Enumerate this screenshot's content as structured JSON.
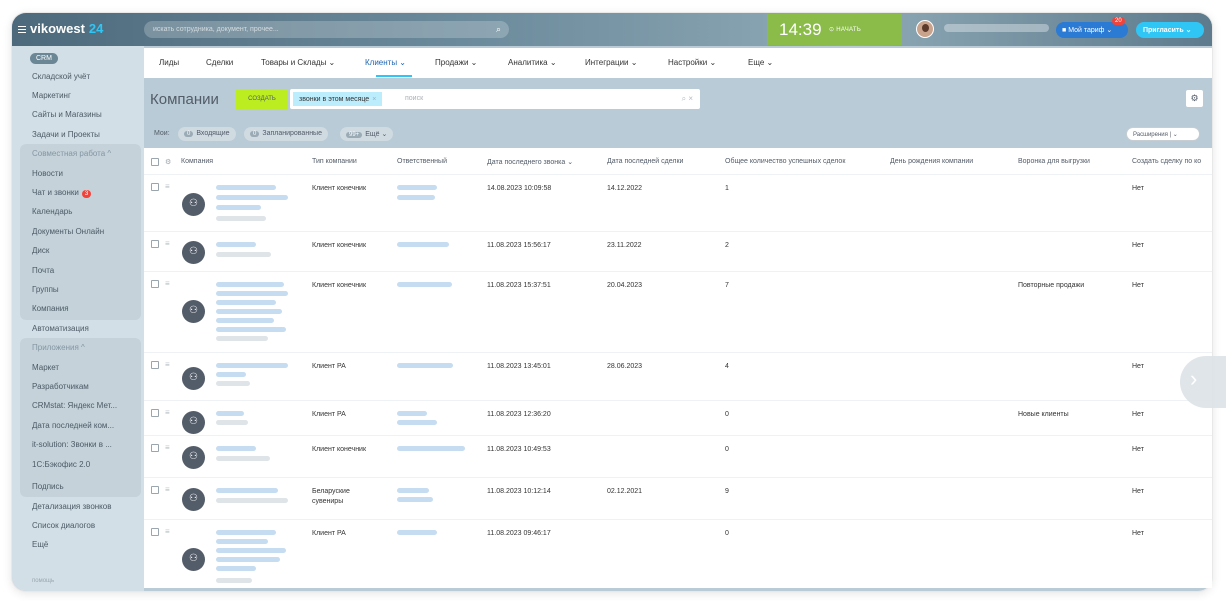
{
  "topbar": {
    "logo": "vikowest",
    "logo_num": "24",
    "search_placeholder": "искать сотрудника, документ, прочее...",
    "time": "14:39",
    "start_label": "НАЧАТЬ",
    "tariff_label": "Мой тариф",
    "tariff_badge": "20",
    "invite_label": "Пригласить"
  },
  "sidebar": {
    "crm": "CRM",
    "items_top": [
      "Складской учёт",
      "Маркетинг",
      "Сайты и Магазины",
      "Задачи и Проекты"
    ],
    "group1_title": "Совместная работа ^",
    "group1": [
      "Новости",
      "Чат и звонки",
      "Календарь",
      "Документы Онлайн",
      "Диск",
      "Почта",
      "Группы",
      "Компания",
      "Автоматизация"
    ],
    "chat_badge": "3",
    "group2_title": "Приложения ^",
    "group2": [
      "Маркет",
      "Разработчикам",
      "CRMstat: Яндекс Мет...",
      "Дата последней ком...",
      "it-solution: Звонки в ...",
      "1С:Бэкофис 2.0"
    ],
    "items_bottom": [
      "Подпись",
      "Детализация звонков",
      "Список диалогов",
      "Ещё"
    ],
    "help": "помощь"
  },
  "nav": {
    "tabs": [
      "Лиды",
      "Сделки",
      "Товары и Склады ⌄",
      "Клиенты ⌄",
      "Продажи ⌄",
      "Аналитика ⌄",
      "Интеграции ⌄",
      "Настройки ⌄",
      "Еще ⌄"
    ]
  },
  "toolbar": {
    "title": "Компании",
    "create_label": "СОЗДАТЬ",
    "filter_chip": "звонки в этом месяце",
    "search_placeholder": "поиск"
  },
  "counters": {
    "my": "Мои:",
    "incoming_n": "0",
    "incoming": "Входящие",
    "planned_n": "0",
    "planned": "Запланированные",
    "more_n": "99+",
    "more": "Ещё ⌄",
    "extensions": "Расширения  |  ⌄"
  },
  "table": {
    "headers": [
      "Компания",
      "Тип компании",
      "Ответственный",
      "Дата последнего звонка ⌄",
      "Дата последней сделки",
      "Общее количество успешных сделок",
      "День рождения компании",
      "Воронка для выгрузки",
      "Создать сделку по ко"
    ],
    "rows": [
      {
        "type": "Клиент конечник",
        "type2": "",
        "call": "14.08.2023 10:09:58",
        "deal": "14.12.2022",
        "count": "1",
        "funnel": "",
        "create": "Нет"
      },
      {
        "type": "Клиент конечник",
        "type2": "",
        "call": "11.08.2023 15:56:17",
        "deal": "23.11.2022",
        "count": "2",
        "funnel": "",
        "create": "Нет"
      },
      {
        "type": "Клиент конечник",
        "type2": "",
        "call": "11.08.2023 15:37:51",
        "deal": "20.04.2023",
        "count": "7",
        "funnel": "Повторные продажи",
        "create": "Нет"
      },
      {
        "type": "Клиент РА",
        "type2": "",
        "call": "11.08.2023 13:45:01",
        "deal": "28.06.2023",
        "count": "4",
        "funnel": "",
        "create": "Нет"
      },
      {
        "type": "Клиент РА",
        "type2": "",
        "call": "11.08.2023 12:36:20",
        "deal": "",
        "count": "0",
        "funnel": "Новые клиенты",
        "create": "Нет"
      },
      {
        "type": "Клиент конечник",
        "type2": "",
        "call": "11.08.2023 10:49:53",
        "deal": "",
        "count": "0",
        "funnel": "",
        "create": "Нет"
      },
      {
        "type": "Беларуские",
        "type2": "сувениры",
        "call": "11.08.2023 10:12:14",
        "deal": "02.12.2021",
        "count": "9",
        "funnel": "",
        "create": "Нет"
      },
      {
        "type": "Клиент РА",
        "type2": "",
        "call": "11.08.2023 09:46:17",
        "deal": "",
        "count": "0",
        "funnel": "",
        "create": "Нет"
      }
    ]
  }
}
